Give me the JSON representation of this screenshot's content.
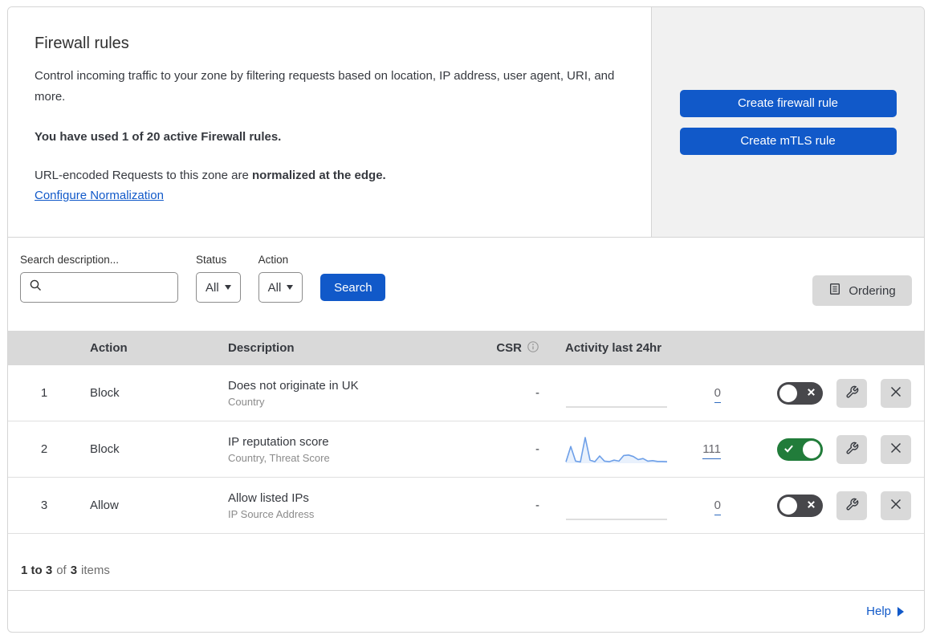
{
  "header": {
    "title": "Firewall rules",
    "description": "Control incoming traffic to your zone by filtering requests based on location, IP address, user agent, URI, and more.",
    "usage": "You have used 1 of 20 active Firewall rules.",
    "normalization_text": "URL-encoded Requests to this zone are ",
    "normalization_bold": "normalized at the edge.",
    "normalization_link": "Configure Normalization",
    "create_firewall_button": "Create firewall rule",
    "create_mtls_button": "Create mTLS rule"
  },
  "filters": {
    "search_label": "Search description...",
    "search_value": "",
    "status_label": "Status",
    "status_value": "All",
    "action_label": "Action",
    "action_value": "All",
    "search_button": "Search",
    "ordering_button": "Ordering"
  },
  "table": {
    "columns": {
      "action": "Action",
      "description": "Description",
      "csr": "CSR",
      "activity": "Activity last 24hr"
    },
    "rows": [
      {
        "number": "1",
        "action": "Block",
        "description": "Does not originate in UK",
        "fields": "Country",
        "csr": "-",
        "count": "0",
        "enabled": false,
        "sparkline": []
      },
      {
        "number": "2",
        "action": "Block",
        "description": "IP reputation score",
        "fields": "Country, Threat Score",
        "csr": "-",
        "count": "111",
        "enabled": true,
        "sparkline": [
          5,
          65,
          8,
          5,
          100,
          12,
          6,
          28,
          8,
          6,
          12,
          8,
          30,
          32,
          26,
          14,
          18,
          8,
          10,
          7,
          7,
          6
        ]
      },
      {
        "number": "3",
        "action": "Allow",
        "description": "Allow listed IPs",
        "fields": "IP Source Address",
        "csr": "-",
        "count": "0",
        "enabled": false,
        "sparkline": []
      }
    ]
  },
  "pagination": {
    "range": "1 to 3",
    "of": "of",
    "total": "3",
    "items": "items"
  },
  "footer": {
    "help_label": "Help"
  },
  "colors": {
    "accent_blue": "#1159c9",
    "toggle_on_green": "#217c3a",
    "toggle_off_gray": "#47474b",
    "spark_line_blue": "#6d9fe8",
    "spark_flat_gray": "#c9c9c9",
    "table_header_gray": "#d9d9d9",
    "panel_gray": "#f1f1f1"
  }
}
